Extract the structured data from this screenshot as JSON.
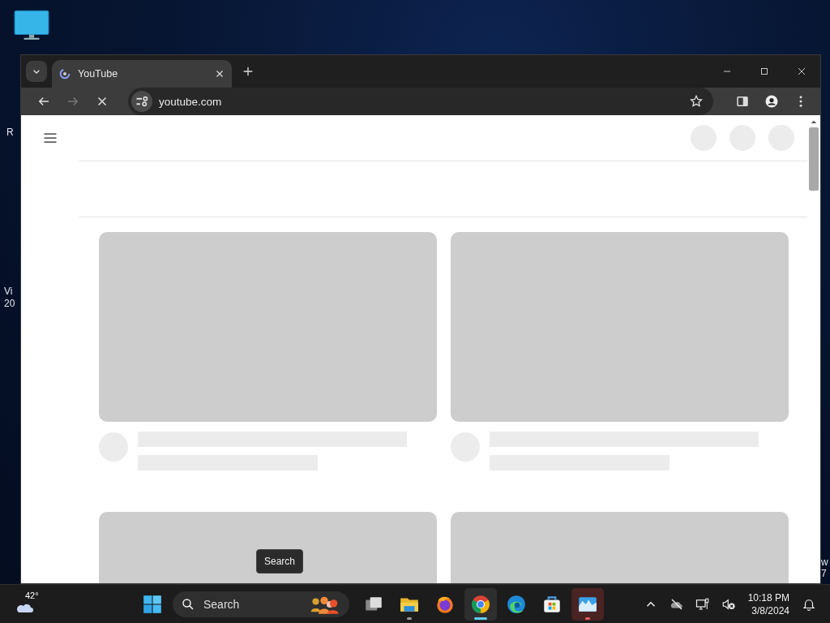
{
  "desktop": {
    "left_fragments": [
      {
        "text": "R"
      },
      {
        "text": "Vi"
      },
      {
        "text": "20"
      }
    ],
    "right_fragments": [
      {
        "text": "w"
      },
      {
        "text": "7"
      }
    ]
  },
  "browser": {
    "tabs": [
      {
        "title": "YouTube",
        "selected": true,
        "loading": true
      }
    ],
    "toolbar": {
      "back_enabled": true,
      "forward_enabled": false,
      "loading": true,
      "address": "youtube.com",
      "bookmarked": false
    },
    "page": {
      "header_placeholders": [
        {
          "kind": "circle"
        },
        {
          "kind": "circle"
        },
        {
          "kind": "circle"
        }
      ],
      "cards": [
        {
          "kind": "full"
        },
        {
          "kind": "full"
        },
        {
          "kind": "thumbnail_only"
        },
        {
          "kind": "thumbnail_only"
        }
      ]
    }
  },
  "tooltip": {
    "text": "Search"
  },
  "taskbar": {
    "weather": {
      "temperature": "42°"
    },
    "search": {
      "placeholder": "Search"
    },
    "apps": [
      {
        "kind": "taskview",
        "running": false,
        "active": false,
        "attention": false
      },
      {
        "kind": "files",
        "running": true,
        "active": false,
        "attention": false
      },
      {
        "kind": "firefox",
        "running": false,
        "active": false,
        "attention": false
      },
      {
        "kind": "chrome",
        "running": true,
        "active": true,
        "attention": false
      },
      {
        "kind": "edge",
        "running": false,
        "active": false,
        "attention": false
      },
      {
        "kind": "store",
        "running": false,
        "active": false,
        "attention": false
      },
      {
        "kind": "photos",
        "running": true,
        "active": false,
        "attention": true
      }
    ],
    "tray": {
      "time": "10:18 PM",
      "date": "3/8/2024"
    }
  }
}
